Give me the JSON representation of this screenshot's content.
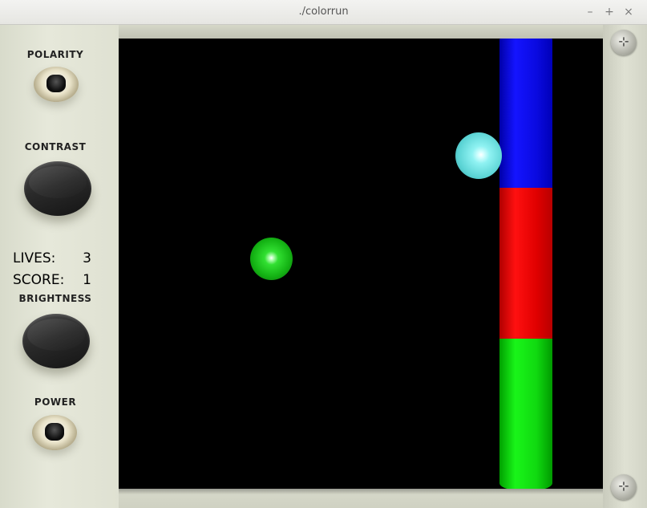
{
  "window": {
    "title": "./colorrun",
    "buttons": {
      "minimize": "–",
      "maximize": "+",
      "close": "×"
    }
  },
  "panel": {
    "labels": {
      "polarity": "POLARITY",
      "contrast": "CONTRAST",
      "brightness": "BRIGHTNESS",
      "power": "POWER"
    },
    "stats": {
      "lives_label": "LIVES:",
      "lives_value": "3",
      "score_label": "SCORE:",
      "score_value": "1"
    }
  },
  "game": {
    "balls": [
      {
        "name": "cyan-ball",
        "color": "#6fe6e8"
      },
      {
        "name": "green-ball",
        "color": "#22cc22"
      }
    ],
    "pillar_segments": [
      {
        "name": "blue",
        "color": "#0a0ae0"
      },
      {
        "name": "red",
        "color": "#e00000"
      },
      {
        "name": "green",
        "color": "#10d910"
      }
    ]
  }
}
